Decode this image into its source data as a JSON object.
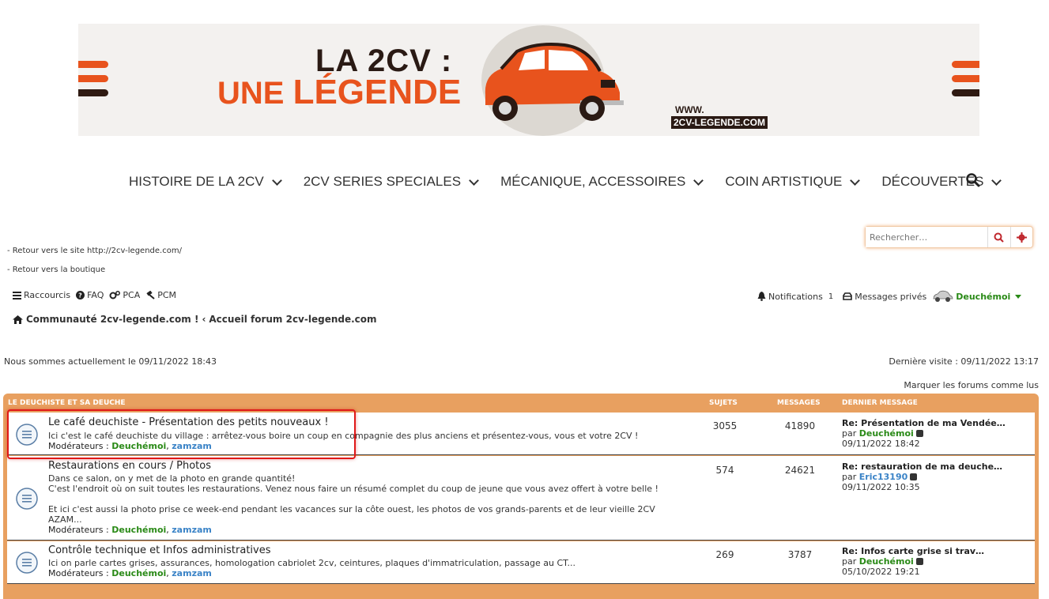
{
  "banner": {
    "line1": "LA 2CV :",
    "line2a": "UNE",
    "line2b": "LÉGENDE",
    "www": "WWW.",
    "domain": "2CV-LEGENDE.COM"
  },
  "nav": {
    "items": [
      {
        "label": "HISTOIRE DE LA 2CV"
      },
      {
        "label": "2CV SERIES SPECIALES"
      },
      {
        "label": "MÉCANIQUE, ACCESSOIRES"
      },
      {
        "label": "COIN ARTISTIQUE"
      },
      {
        "label": "DÉCOUVERTES"
      }
    ]
  },
  "search": {
    "placeholder": "Rechercher…"
  },
  "links": {
    "site": "- Retour vers le site http://2cv-legende.com/",
    "shop": "- Retour vers la boutique"
  },
  "toolbar": {
    "shortcuts": "Raccourcis",
    "faq": "FAQ",
    "pca": "PCA",
    "pcm": "PCM",
    "notifications": "Notifications",
    "notif_count": "1",
    "pm": "Messages privés",
    "username": "Deuchémoi"
  },
  "breadcrumb": {
    "home": "Communauté 2cv-legende.com !",
    "forum": "Accueil forum 2cv-legende.com"
  },
  "status": {
    "current_time": "Nous sommes actuellement le 09/11/2022 18:43",
    "last_visit": "Dernière visite : 09/11/2022 13:17",
    "mark_read": "Marquer les forums comme lus"
  },
  "forum": {
    "header": {
      "category": "LE DEUCHISTE ET SA DEUCHE",
      "topics": "SUJETS",
      "posts": "MESSAGES",
      "last": "DERNIER MESSAGE"
    },
    "mods_label": "Modérateurs :",
    "mod1": "Deuchémoi",
    "mod2": "zamzam",
    "rows": [
      {
        "title": "Le café deuchiste - Présentation des petits nouveaux !",
        "desc": "Ici c'est le café deuchiste du village : arrêtez-vous boire un coup en compagnie des plus anciens et présentez-vous, vous et votre 2CV !",
        "topics": "3055",
        "posts": "41890",
        "last_title": "Re: Présentation de ma Vendée…",
        "last_by": "par",
        "last_user": "Deuchémoi",
        "last_date": "09/11/2022 18:42"
      },
      {
        "title": "Restaurations en cours / Photos",
        "desc1": "Dans ce salon, on y met de la photo en grande quantité!",
        "desc2": "C'est l'endroit où on suit toutes les restaurations. Venez nous faire un résumé complet du coup de jeune que vous avez offert à votre belle !",
        "desc3": "Et ici c'est aussi la photo prise ce week-end pendant les vacances sur la côte ouest, les photos de vos grands-parents et de leur vieille 2CV",
        "desc4": "AZAM...",
        "topics": "574",
        "posts": "24621",
        "last_title": "Re: restauration de ma deuche…",
        "last_by": "par",
        "last_user": "Eric13190",
        "last_date": "09/11/2022 10:35"
      },
      {
        "title": "Contrôle technique et Infos administratives",
        "desc": "Ici on parle cartes grises, assurances, homologation cabriolet 2cv, ceintures, plaques d'immatriculation, passage au CT...",
        "topics": "269",
        "posts": "3787",
        "last_title": "Re: Infos carte grise si trav…",
        "last_by": "par",
        "last_user": "Deuchémoi",
        "last_date": "05/10/2022 19:21"
      }
    ]
  }
}
